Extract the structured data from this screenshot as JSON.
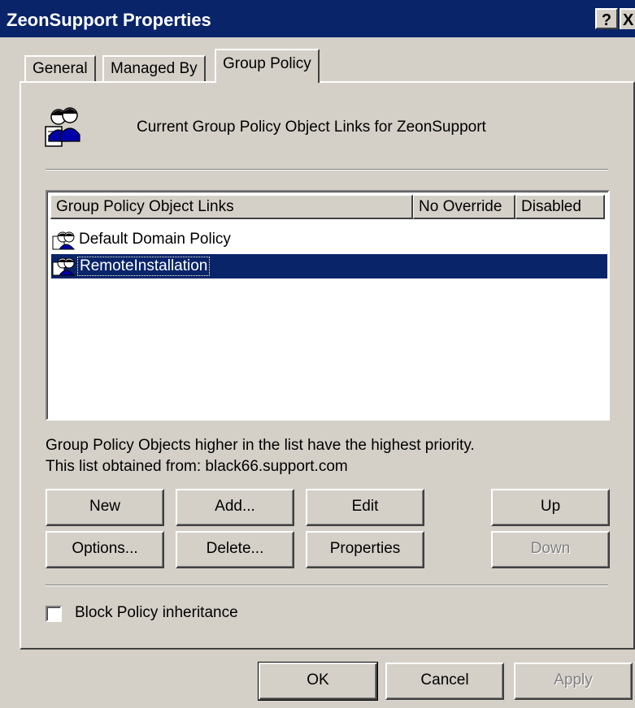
{
  "window": {
    "title": "ZeonSupport Properties",
    "help_button": "?",
    "close_button": "X"
  },
  "tabs": [
    {
      "label": "General",
      "active": false
    },
    {
      "label": "Managed By",
      "active": false
    },
    {
      "label": "Group Policy",
      "active": true
    }
  ],
  "panel": {
    "heading": "Current Group Policy Object Links for ZeonSupport",
    "icon": "users-icon"
  },
  "listview": {
    "columns": [
      "Group Policy Object Links",
      "No Override",
      "Disabled"
    ],
    "rows": [
      {
        "name": "Default Domain Policy",
        "icon": "gpo-icon",
        "selected": false
      },
      {
        "name": "RemoteInstallation",
        "icon": "gpo-icon",
        "selected": true
      }
    ]
  },
  "info": {
    "priority_text": "Group Policy Objects higher in the list have the highest priority.",
    "source_text": "This list obtained from: black66.support.com"
  },
  "buttons": {
    "new": "New",
    "add": "Add...",
    "edit": "Edit",
    "up": "Up",
    "options": "Options...",
    "delete": "Delete...",
    "properties": "Properties",
    "down": "Down"
  },
  "block_inheritance": {
    "label": "Block Policy inheritance",
    "checked": false
  },
  "dialog_buttons": {
    "ok": "OK",
    "cancel": "Cancel",
    "apply": "Apply"
  },
  "colors": {
    "titlebar": "#0a246a",
    "selection": "#0a246a",
    "face": "#d4d0c8"
  }
}
